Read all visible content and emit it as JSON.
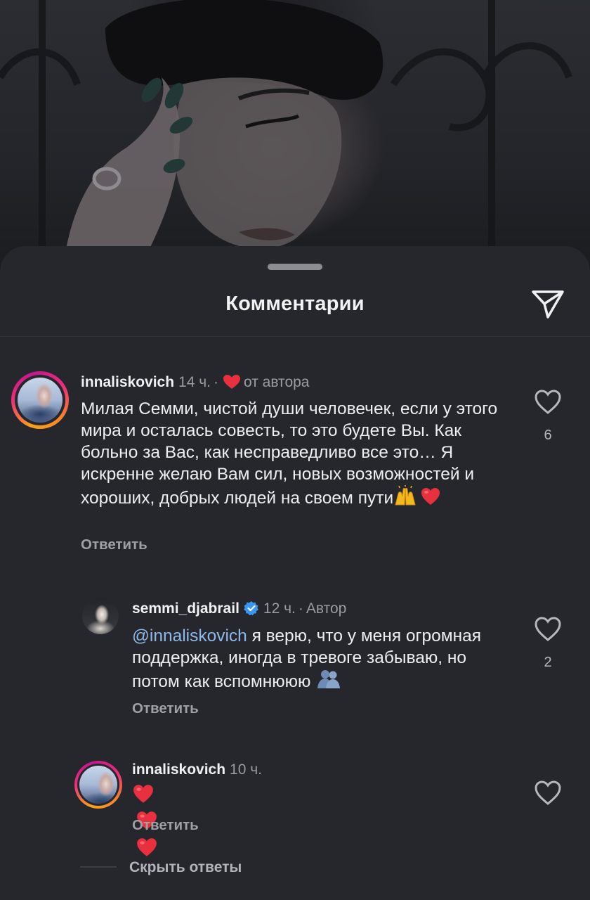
{
  "sheet": {
    "title": "Комментарии"
  },
  "comments": [
    {
      "username": "innaliskovich",
      "time": "14 ч.",
      "separator": "·",
      "badge": "от автора",
      "text": "Милая Семми, чистой души человечек, если у этого мира и осталась совесть, то это будете Вы. Как больно  за Вас, как несправедливо все это… Я искренне желаю Вам сил, новых возможностей и хороших, добрых людей на своем пути",
      "trailing_emojis": [
        "raising-hands-emoji",
        "red-heart-emoji"
      ],
      "reply_label": "Ответить",
      "likes": "6"
    },
    {
      "username": "semmi_djabrail",
      "verified": true,
      "time": "12 ч.",
      "separator": "·",
      "badge": "Автор",
      "mention": "@innaliskovich",
      "text": " я верю, что у меня огромная поддержка, иногда в тревоге забываю, но потом как вспомнююю",
      "trailing_emojis": [
        "hugging-people-emoji"
      ],
      "reply_label": "Ответить",
      "likes": "2"
    },
    {
      "username": "innaliskovich",
      "time": "10 ч.",
      "trailing_emojis": [
        "red-heart-emoji",
        "red-heart-emoji",
        "red-heart-emoji"
      ],
      "reply_label": "Ответить"
    }
  ],
  "hide_replies_label": "Скрыть ответы",
  "colors": {
    "sheet_bg": "#25272d",
    "mention": "#8fb8ea",
    "heart_red": "#e8303f",
    "verified_blue": "#3897f0"
  }
}
